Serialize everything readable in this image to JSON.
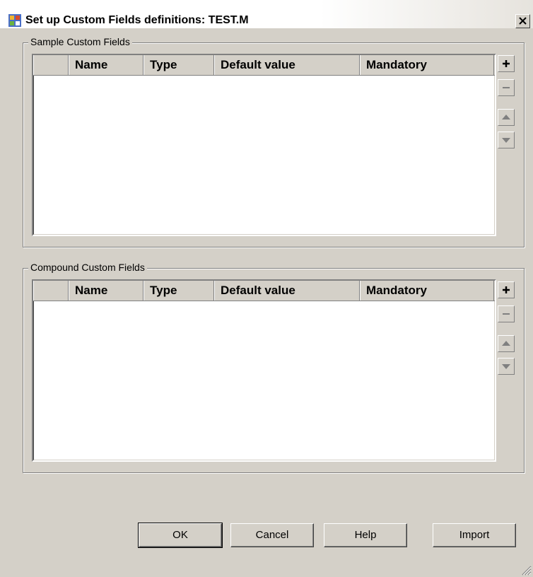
{
  "window": {
    "title": "Set up Custom Fields definitions: TEST.M",
    "close_glyph": "✕"
  },
  "sample_group": {
    "label": "Sample Custom Fields",
    "columns": [
      "",
      "Name",
      "Type",
      "Default value",
      "Mandatory"
    ],
    "rows": []
  },
  "compound_group": {
    "label": "Compound Custom Fields",
    "columns": [
      "",
      "Name",
      "Type",
      "Default value",
      "Mandatory"
    ],
    "rows": []
  },
  "side_buttons": {
    "add_icon": "plus-icon",
    "remove_icon": "minus-icon",
    "up_icon": "arrow-up-icon",
    "down_icon": "arrow-down-icon"
  },
  "buttons": {
    "ok": "OK",
    "cancel": "Cancel",
    "help": "Help",
    "import": "Import"
  },
  "colors": {
    "dialog_bg": "#d4d0c8",
    "grid_bg": "#ffffff"
  }
}
